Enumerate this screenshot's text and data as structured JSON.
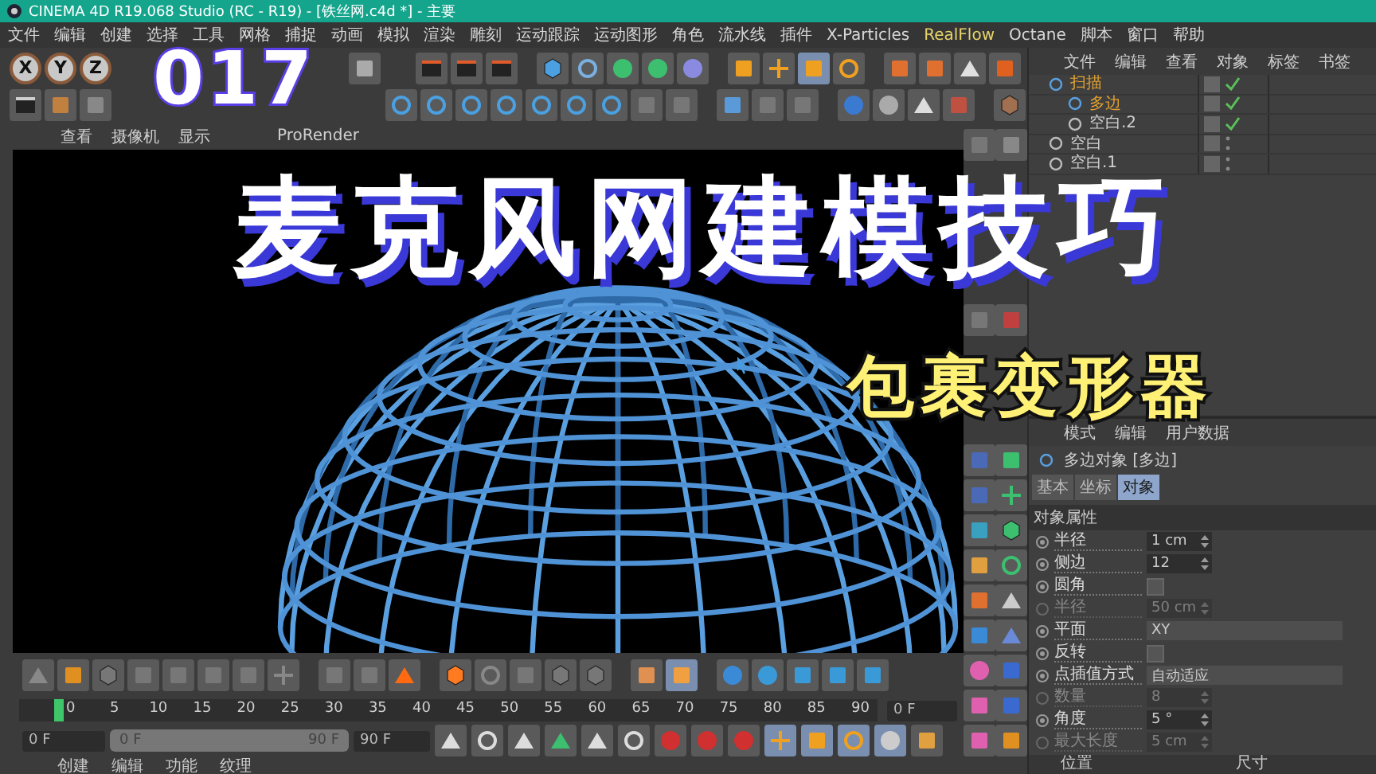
{
  "window": {
    "title": "CINEMA 4D R19.068 Studio (RC - R19) - [铁丝网.c4d *] - 主要"
  },
  "menu": [
    {
      "label": "文件",
      "highlight": false
    },
    {
      "label": "编辑",
      "highlight": false
    },
    {
      "label": "创建",
      "highlight": false
    },
    {
      "label": "选择",
      "highlight": false
    },
    {
      "label": "工具",
      "highlight": false
    },
    {
      "label": "网格",
      "highlight": false
    },
    {
      "label": "捕捉",
      "highlight": false
    },
    {
      "label": "动画",
      "highlight": false
    },
    {
      "label": "模拟",
      "highlight": false
    },
    {
      "label": "渲染",
      "highlight": false
    },
    {
      "label": "雕刻",
      "highlight": false
    },
    {
      "label": "运动跟踪",
      "highlight": false
    },
    {
      "label": "运动图形",
      "highlight": false
    },
    {
      "label": "角色",
      "highlight": false
    },
    {
      "label": "流水线",
      "highlight": false
    },
    {
      "label": "插件",
      "highlight": false
    },
    {
      "label": "X-Particles",
      "highlight": false
    },
    {
      "label": "RealFlow",
      "highlight": true
    },
    {
      "label": "Octane",
      "highlight": false
    },
    {
      "label": "脚本",
      "highlight": false
    },
    {
      "label": "窗口",
      "highlight": false
    },
    {
      "label": "帮助",
      "highlight": false
    }
  ],
  "axis_buttons": [
    "X",
    "Y",
    "Z"
  ],
  "viewport": {
    "menu": [
      "查看",
      "摄像机",
      "显示",
      "ProRender"
    ]
  },
  "overlay": {
    "number": "017",
    "title": "麦克风网建模技巧",
    "subtitle": "包裹变形器"
  },
  "timeline": {
    "ticks": [
      "0",
      "5",
      "10",
      "15",
      "20",
      "25",
      "30",
      "35",
      "40",
      "45",
      "50",
      "55",
      "60",
      "65",
      "70",
      "75",
      "80",
      "85",
      "90"
    ],
    "level": 0,
    "frame": "0 F"
  },
  "transport": {
    "start": "0 F",
    "range_start": "0 F",
    "range_end": "90 F",
    "end": "90 F",
    "level": 1
  },
  "bottom_tabs": [
    "创建",
    "编辑",
    "功能",
    "纹理"
  ],
  "object_manager": {
    "menu": [
      "文件",
      "编辑",
      "查看",
      "对象",
      "标签",
      "书签"
    ],
    "objects": [
      {
        "name": "扫描",
        "selected": true,
        "enabled": true,
        "children": [
          {
            "name": "多边",
            "selected": true,
            "enabled": true
          },
          {
            "name": "空白.2",
            "selected": false,
            "enabled": true
          }
        ]
      },
      {
        "name": "空白",
        "selected": false,
        "enabled": false
      },
      {
        "name": "空白.1",
        "selected": false,
        "enabled": false
      }
    ]
  },
  "attributes": {
    "menu": [
      "模式",
      "编辑",
      "用户数据"
    ],
    "object": "多边对象 [多边]",
    "tabs": [
      {
        "label": "基本",
        "selected": false
      },
      {
        "label": "坐标",
        "selected": false
      },
      {
        "label": "对象",
        "selected": true
      }
    ],
    "section": "对象属性",
    "rows": [
      {
        "kind": "field",
        "label": "半径",
        "value": "1 cm",
        "disabled": false
      },
      {
        "kind": "field",
        "label": "侧边",
        "value": "12",
        "disabled": false
      },
      {
        "kind": "check",
        "label": "圆角",
        "checked": false,
        "disabled": false
      },
      {
        "kind": "field",
        "label": "半径",
        "value": "50 cm",
        "disabled": true
      },
      {
        "kind": "select",
        "label": "平面",
        "value": "XY",
        "disabled": false
      },
      {
        "kind": "check",
        "label": "反转",
        "checked": false,
        "disabled": false
      },
      {
        "kind": "select",
        "label": "点插值方式",
        "value": "自动适应",
        "disabled": false
      },
      {
        "kind": "field",
        "label": "数量",
        "value": "8",
        "disabled": true
      },
      {
        "kind": "field",
        "label": "角度",
        "value": "5 °",
        "disabled": false
      },
      {
        "kind": "field",
        "label": "最大长度",
        "value": "5 cm",
        "disabled": true
      }
    ],
    "footer": [
      "位置",
      "尺寸"
    ]
  }
}
